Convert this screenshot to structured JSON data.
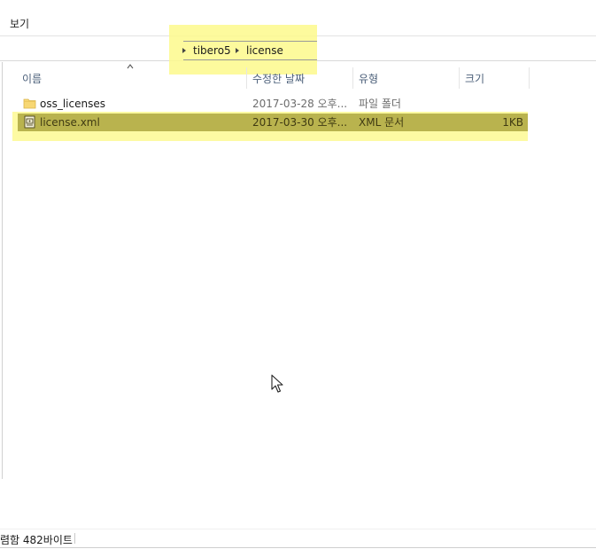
{
  "ribbon": {
    "tabs": [
      {
        "label": "보기"
      }
    ]
  },
  "address": {
    "crumbs": [
      {
        "label": "tibero5"
      },
      {
        "label": "license"
      }
    ]
  },
  "columns": {
    "name": "이름",
    "date": "수정한 날짜",
    "type": "유형",
    "size": "크기"
  },
  "files": [
    {
      "name": "oss_licenses",
      "date": "2017-03-28 오후...",
      "type": "파일 폴더",
      "size": "",
      "icon": "folder-icon",
      "selected": false
    },
    {
      "name": "license.xml",
      "date": "2017-03-30 오후...",
      "type": "XML 문서",
      "size": "1KB",
      "icon": "xml-document-icon",
      "selected": true
    }
  ],
  "status": {
    "text": "렴함 482바이트"
  },
  "colors": {
    "highlight": "#fdf98c",
    "selected_row": "#b9b34e",
    "header_text": "#4c607a"
  }
}
